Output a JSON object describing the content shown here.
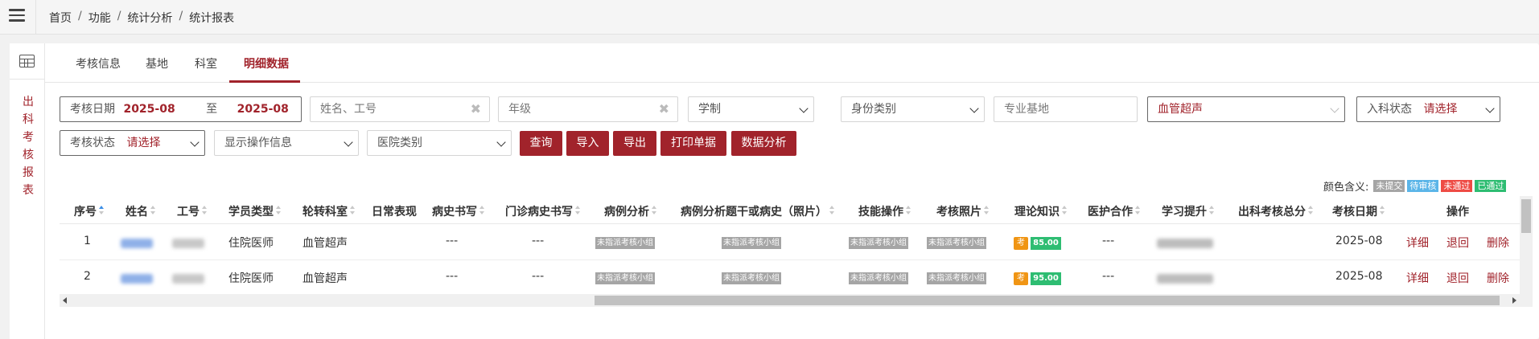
{
  "breadcrumb": {
    "home": "首页",
    "sep": "/",
    "l1": "功能",
    "l2": "统计分析",
    "l3": "统计报表"
  },
  "side_title": [
    "出",
    "科",
    "考",
    "核",
    "报",
    "表"
  ],
  "tabs": [
    "考核信息",
    "基地",
    "科室",
    "明细数据"
  ],
  "active_tab": "明细数据",
  "filters": {
    "date_label": "考核日期",
    "date_from": "2025-08",
    "date_to_sep": "至",
    "date_to": "2025-08",
    "name_placeholder": "姓名、工号",
    "grade_placeholder": "年级",
    "system_select": "学制",
    "identity_select": "身份类别",
    "base_placeholder": "专业基地",
    "dept_select": "血管超声",
    "entry_label": "入科状态",
    "entry_value": "请选择",
    "exam_label": "考核状态",
    "exam_value": "请选择",
    "show_ops": "显示操作信息",
    "hospital_type": "医院类别"
  },
  "buttons": {
    "query": "查询",
    "import": "导入",
    "export": "导出",
    "print": "打印单据",
    "analysis": "数据分析"
  },
  "legend": {
    "label": "颜色含义:",
    "items": [
      {
        "text": "未提交",
        "color": "#a5a5a5"
      },
      {
        "text": "待审核",
        "color": "#5bb5e8"
      },
      {
        "text": "未通过",
        "color": "#ee4b44"
      },
      {
        "text": "已通过",
        "color": "#2ebd72"
      }
    ]
  },
  "table": {
    "headers": [
      "序号",
      "姓名",
      "工号",
      "学员类型",
      "轮转科室",
      "日常表现",
      "病史书写",
      "门诊病史书写",
      "病例分析",
      "病例分析题干或病史（照片）",
      "技能操作",
      "考核照片",
      "理论知识",
      "医护合作",
      "学习提升",
      "出科考核总分",
      "考核日期",
      "操作"
    ],
    "rows": [
      {
        "no": "1",
        "type": "住院医师",
        "dept": "血管超声",
        "history": "---",
        "outpatient": "---",
        "case": "未指派考核小组",
        "case_photo": "未指派考核小组",
        "skill": "未指派考核小组",
        "photo": "未指派考核小组",
        "kao": "考",
        "score": "85.00",
        "nursing": "---",
        "date": "2025-08",
        "detail": "详细",
        "back": "退回",
        "delete": "删除"
      },
      {
        "no": "2",
        "type": "住院医师",
        "dept": "血管超声",
        "history": "---",
        "outpatient": "---",
        "case": "未指派考核小组",
        "case_photo": "未指派考核小组",
        "skill": "未指派考核小组",
        "photo": "未指派考核小组",
        "kao": "考",
        "score": "95.00",
        "nursing": "---",
        "date": "2025-08",
        "detail": "详细",
        "back": "退回",
        "delete": "删除"
      }
    ]
  },
  "colors": {
    "accent": "#a1232b",
    "status_gray": "#a5a5a5",
    "score_green": "#2ebd72",
    "kao_orange": "#f09514"
  }
}
